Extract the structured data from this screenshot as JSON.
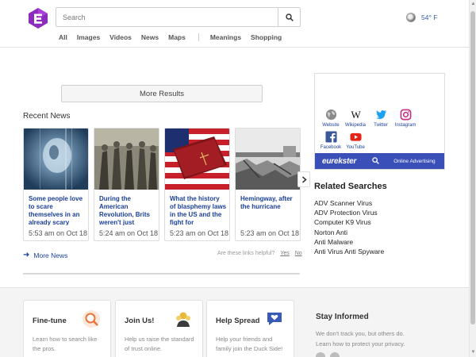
{
  "header": {
    "search": {
      "placeholder": "Search",
      "value": ""
    },
    "nav": [
      "All",
      "Images",
      "Videos",
      "News",
      "Maps"
    ],
    "nav_secondary": [
      "Meanings",
      "Shopping"
    ],
    "weather": {
      "temp": "54° F",
      "icon": "moon-icon"
    }
  },
  "main": {
    "more_results_label": "More Results",
    "recent_news_title": "Recent News",
    "news": [
      {
        "title": "Some people love to scare themselves in an already scary",
        "time": "5:53 am on Oct 18"
      },
      {
        "title": "During the American Revolution, Brits weren't just",
        "time": "5:24 am on Oct 18"
      },
      {
        "title": "What the history of blasphemy laws in the US and the fight for",
        "time": "5:23 am on Oct 18"
      },
      {
        "title": "Hemingway, after the hurricane",
        "time": "5:23 am on Oct 18"
      }
    ],
    "more_news_label": "More News",
    "helpful": {
      "question": "Are these links helpful?",
      "yes": "Yes",
      "no": "No"
    }
  },
  "sidebar": {
    "social": [
      {
        "label": "Website",
        "icon": "globe-icon"
      },
      {
        "label": "Wikipedia",
        "icon": "wikipedia-icon"
      },
      {
        "label": "Twitter",
        "icon": "twitter-icon"
      },
      {
        "label": "Instagram",
        "icon": "instagram-icon"
      },
      {
        "label": "Facebook",
        "icon": "facebook-icon"
      },
      {
        "label": "YouTube",
        "icon": "youtube-icon"
      }
    ],
    "eurekster": {
      "logo": "eurekster",
      "ads": "Online Advertising"
    },
    "related_title": "Related Searches",
    "related": [
      "ADV Scanner Virus",
      "ADV Protection Virus",
      "Computer K9 Virus",
      "Norton Anti",
      "Anti Malware",
      "Anti Virus Anti Spyware"
    ]
  },
  "footer": {
    "cards": [
      {
        "title": "Fine-tune",
        "text": "Learn how to search like the pros.",
        "icon": "magnifier-icon"
      },
      {
        "title": "Join Us!",
        "text": "Help us raise the standard of trust online.",
        "icon": "people-icon"
      },
      {
        "title": "Help Spread",
        "text": "Help your friends and family join the Duck Side!",
        "icon": "heart-bubble-icon"
      }
    ],
    "stay_title": "Stay Informed",
    "stay_text": "We don't track you, but others do. Learn how to protect your privacy."
  },
  "colors": {
    "link": "#1a3f9a",
    "eurekster_bar": "#3a4fb8",
    "logo": "#8b2bbf"
  }
}
